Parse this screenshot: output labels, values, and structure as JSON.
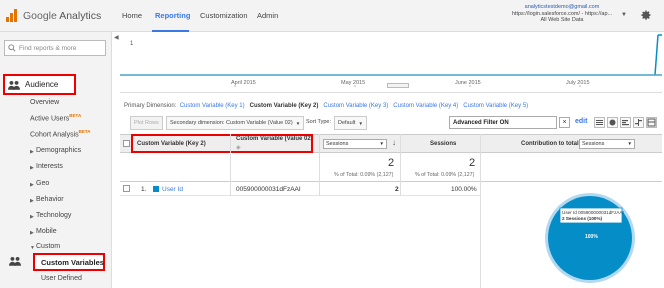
{
  "header": {
    "logo_google": "Google",
    "logo_analytics": "Analytics",
    "nav": [
      "Home",
      "Reporting",
      "Customization",
      "Admin"
    ],
    "account_email": "analyticstestdemo@gmail.com",
    "account_property": "https://login.salesforce.com/ - https://ap...",
    "account_view": "All Web Site Data"
  },
  "sidebar": {
    "search_placeholder": "Find reports & more",
    "audience_label": "Audience",
    "items": [
      {
        "label": "Overview"
      },
      {
        "label": "Active Users",
        "badge": "BETA"
      },
      {
        "label": "Cohort Analysis",
        "badge": "BETA"
      },
      {
        "label": "Demographics"
      },
      {
        "label": "Interests"
      },
      {
        "label": "Geo"
      },
      {
        "label": "Behavior"
      },
      {
        "label": "Technology"
      },
      {
        "label": "Mobile"
      },
      {
        "label": "Custom"
      }
    ],
    "custom_variables_label": "Custom Variables",
    "user_defined_label": "User Defined"
  },
  "chart": {
    "y_label": "1",
    "x_ticks": [
      "April 2015",
      "May 2015",
      "June 2015",
      "July 2015"
    ]
  },
  "primary_dimension": {
    "label": "Primary Dimension:",
    "options": [
      "Custom Variable (Key 1)",
      "Custom Variable (Key 2)",
      "Custom Variable (Key 3)",
      "Custom Variable (Key 4)",
      "Custom Variable (Key 5)"
    ],
    "active_index": 1
  },
  "toolbar": {
    "plot_rows": "Plot Rows",
    "secondary_dimension": "Secondary dimension: Custom Variable (Value 02)",
    "sort_type_label": "Sort Type:",
    "sort_type_value": "Default",
    "advanced_filter": "Advanced Filter ON",
    "clear": "×",
    "edit": "edit"
  },
  "table": {
    "col_key": "Custom Variable (Key 2)",
    "col_value": "Custom Variable (Value 02)",
    "metric_select": "Sessions",
    "col_sessions": "Sessions",
    "col_contribution": "Contribution to total:",
    "contribution_select": "Sessions",
    "total_sessions_1": "2",
    "total_pct_1": "% of Total: 0.09% (2,127)",
    "total_sessions_2": "2",
    "total_pct_2": "% of Total: 0.09% (2,127)",
    "rows": [
      {
        "index": "1.",
        "key": "User Id",
        "value": "005900000031dFzAAI",
        "sessions": "2",
        "pct": "100.00%"
      }
    ]
  },
  "pie": {
    "tooltip_line1": "User Id 005900000031dFzAAI",
    "tooltip_line2": "2 Sessions (100%)",
    "slice_label": "100%",
    "color": "#058dc7"
  }
}
